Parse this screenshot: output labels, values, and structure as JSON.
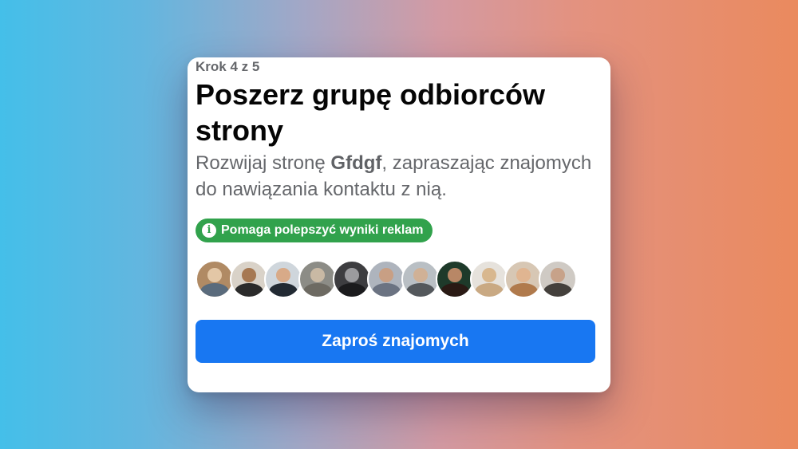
{
  "card": {
    "step_text": "Krok 4 z 5",
    "title": "Poszerz grupę odbiorców strony",
    "description_prefix": "Rozwijaj stronę ",
    "page_name": "Gfdgf",
    "description_suffix": ", zapraszając znajomych do nawiązania kontaktu z nią.",
    "badge": {
      "icon": "info-icon",
      "label": "Pomaga polepszyć wyniki reklam",
      "color": "#31a24c"
    },
    "friend_avatar_count": 11,
    "invite_button_label": "Zaproś znajomych",
    "accent_color": "#1877f2"
  }
}
